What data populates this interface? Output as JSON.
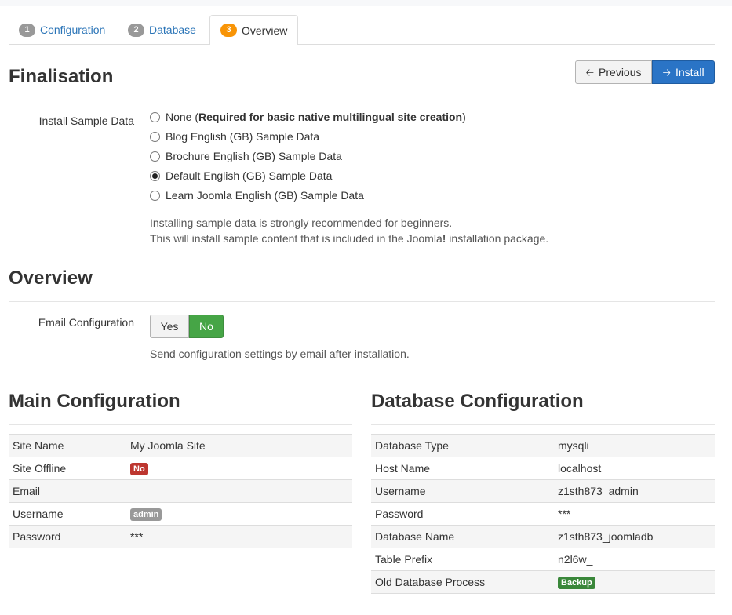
{
  "tabs": [
    {
      "num": "1",
      "label": "Configuration"
    },
    {
      "num": "2",
      "label": "Database"
    },
    {
      "num": "3",
      "label": "Overview"
    }
  ],
  "nav": {
    "previous_label": "Previous",
    "install_label": "Install"
  },
  "finalisation": {
    "title": "Finalisation",
    "sample_data_label": "Install Sample Data",
    "options": {
      "none_prefix": "None (",
      "none_bold": "Required for basic native multilingual site creation",
      "none_suffix": ")",
      "blog": "Blog English (GB) Sample Data",
      "brochure": "Brochure English (GB) Sample Data",
      "default": "Default English (GB) Sample Data",
      "learn": "Learn Joomla English (GB) Sample Data"
    },
    "selected": "Default English (GB) Sample Data",
    "help_line1": "Installing sample data is strongly recommended for beginners.",
    "help_line2_prefix": "This will install sample content that is included in the Joomla",
    "help_line2_bold": "!",
    "help_line2_suffix": " installation package."
  },
  "overview": {
    "title": "Overview",
    "email_label": "Email Configuration",
    "yes_label": "Yes",
    "no_label": "No",
    "selected": "No",
    "help": "Send configuration settings by email after installation."
  },
  "main_config": {
    "title": "Main Configuration",
    "rows": {
      "site_name": {
        "label": "Site Name",
        "value": "My Joomla Site"
      },
      "site_offline": {
        "label": "Site Offline",
        "value": "No"
      },
      "email": {
        "label": "Email",
        "value": ""
      },
      "username": {
        "label": "Username",
        "value": "admin"
      },
      "password": {
        "label": "Password",
        "value": "***"
      }
    }
  },
  "db_config": {
    "title": "Database Configuration",
    "rows": {
      "type": {
        "label": "Database Type",
        "value": "mysqli"
      },
      "host": {
        "label": "Host Name",
        "value": "localhost"
      },
      "username": {
        "label": "Username",
        "value": "z1sth873_admin"
      },
      "password": {
        "label": "Password",
        "value": "***"
      },
      "name": {
        "label": "Database Name",
        "value": "z1sth873_joomladb"
      },
      "prefix": {
        "label": "Table Prefix",
        "value": "n2l6w_"
      },
      "old_process": {
        "label": "Old Database Process",
        "value": "Backup"
      }
    }
  },
  "colors": {
    "link": "#2a74b7",
    "active_tab_badge": "#f89406",
    "install_button": "#2a74c6",
    "no_toggle": "#46a546",
    "badge_red": "#bd362f",
    "badge_green": "#3a873a"
  }
}
